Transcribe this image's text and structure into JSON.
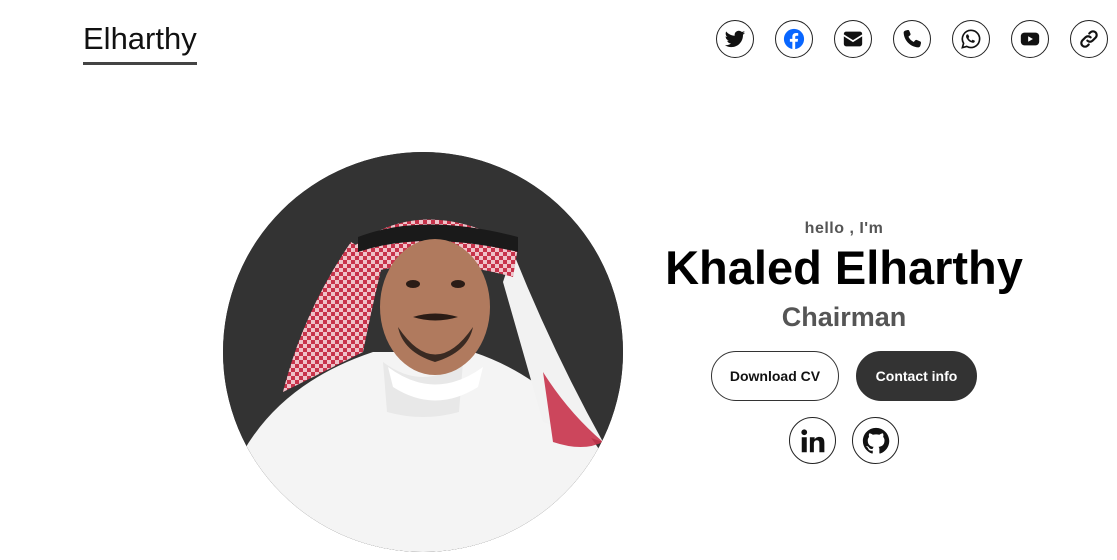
{
  "header": {
    "brand": "Elharthy",
    "social": [
      {
        "icon": "twitter-icon",
        "color": "#111111"
      },
      {
        "icon": "facebook-icon",
        "color": "#0866ff"
      },
      {
        "icon": "envelope-icon",
        "color": "#111111"
      },
      {
        "icon": "phone-icon",
        "color": "#111111"
      },
      {
        "icon": "whatsapp-icon",
        "color": "#111111"
      },
      {
        "icon": "youtube-icon",
        "color": "#111111"
      },
      {
        "icon": "link-icon",
        "color": "#111111"
      }
    ]
  },
  "hero": {
    "greeting": "hello , I'm",
    "name": "Khaled Elharthy",
    "role": "Chairman",
    "buttons": {
      "download_cv": "Download CV",
      "contact_info": "Contact info"
    },
    "profiles": [
      {
        "icon": "linkedin-icon"
      },
      {
        "icon": "github-icon"
      }
    ],
    "portrait_background": "#333333"
  },
  "colors": {
    "text": "#111111",
    "muted": "#555555",
    "dark": "#333333",
    "facebook": "#0866ff"
  }
}
